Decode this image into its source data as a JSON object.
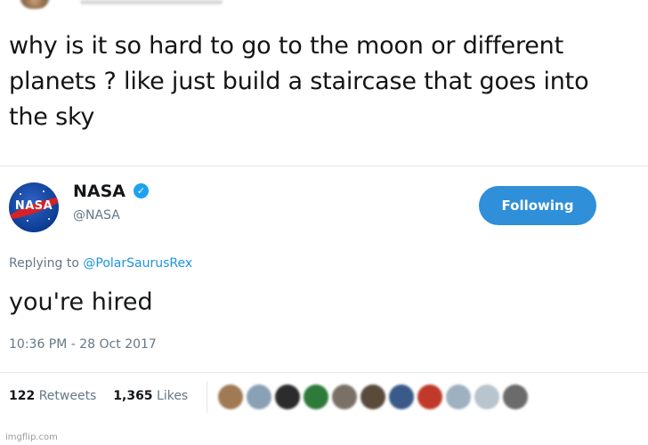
{
  "original_tweet": {
    "text": "why is it so hard to go to the moon or different planets ? like just build a staircase that goes into the sky"
  },
  "reply_tweet": {
    "avatar_label": "NASA",
    "author_name": "NASA",
    "handle": "@NASA",
    "follow_button_label": "Following",
    "replying_to_label": "Replying to",
    "replying_to_handle": "@PolarSaurusRex",
    "text": "you're hired",
    "timestamp": "10:36 PM - 28 Oct 2017",
    "retweets_count": "122",
    "retweets_label": "Retweets",
    "likes_count": "1,365",
    "likes_label": "Likes",
    "liker_avatar_count": 11
  },
  "watermark": "imgflip.com",
  "colors": {
    "accent_blue": "#1da1f2",
    "follow_button": "#2f8fd8",
    "secondary_text": "#657786",
    "mention_link": "#1b95e0"
  },
  "icons": {
    "verified": "verified-badge-icon"
  }
}
